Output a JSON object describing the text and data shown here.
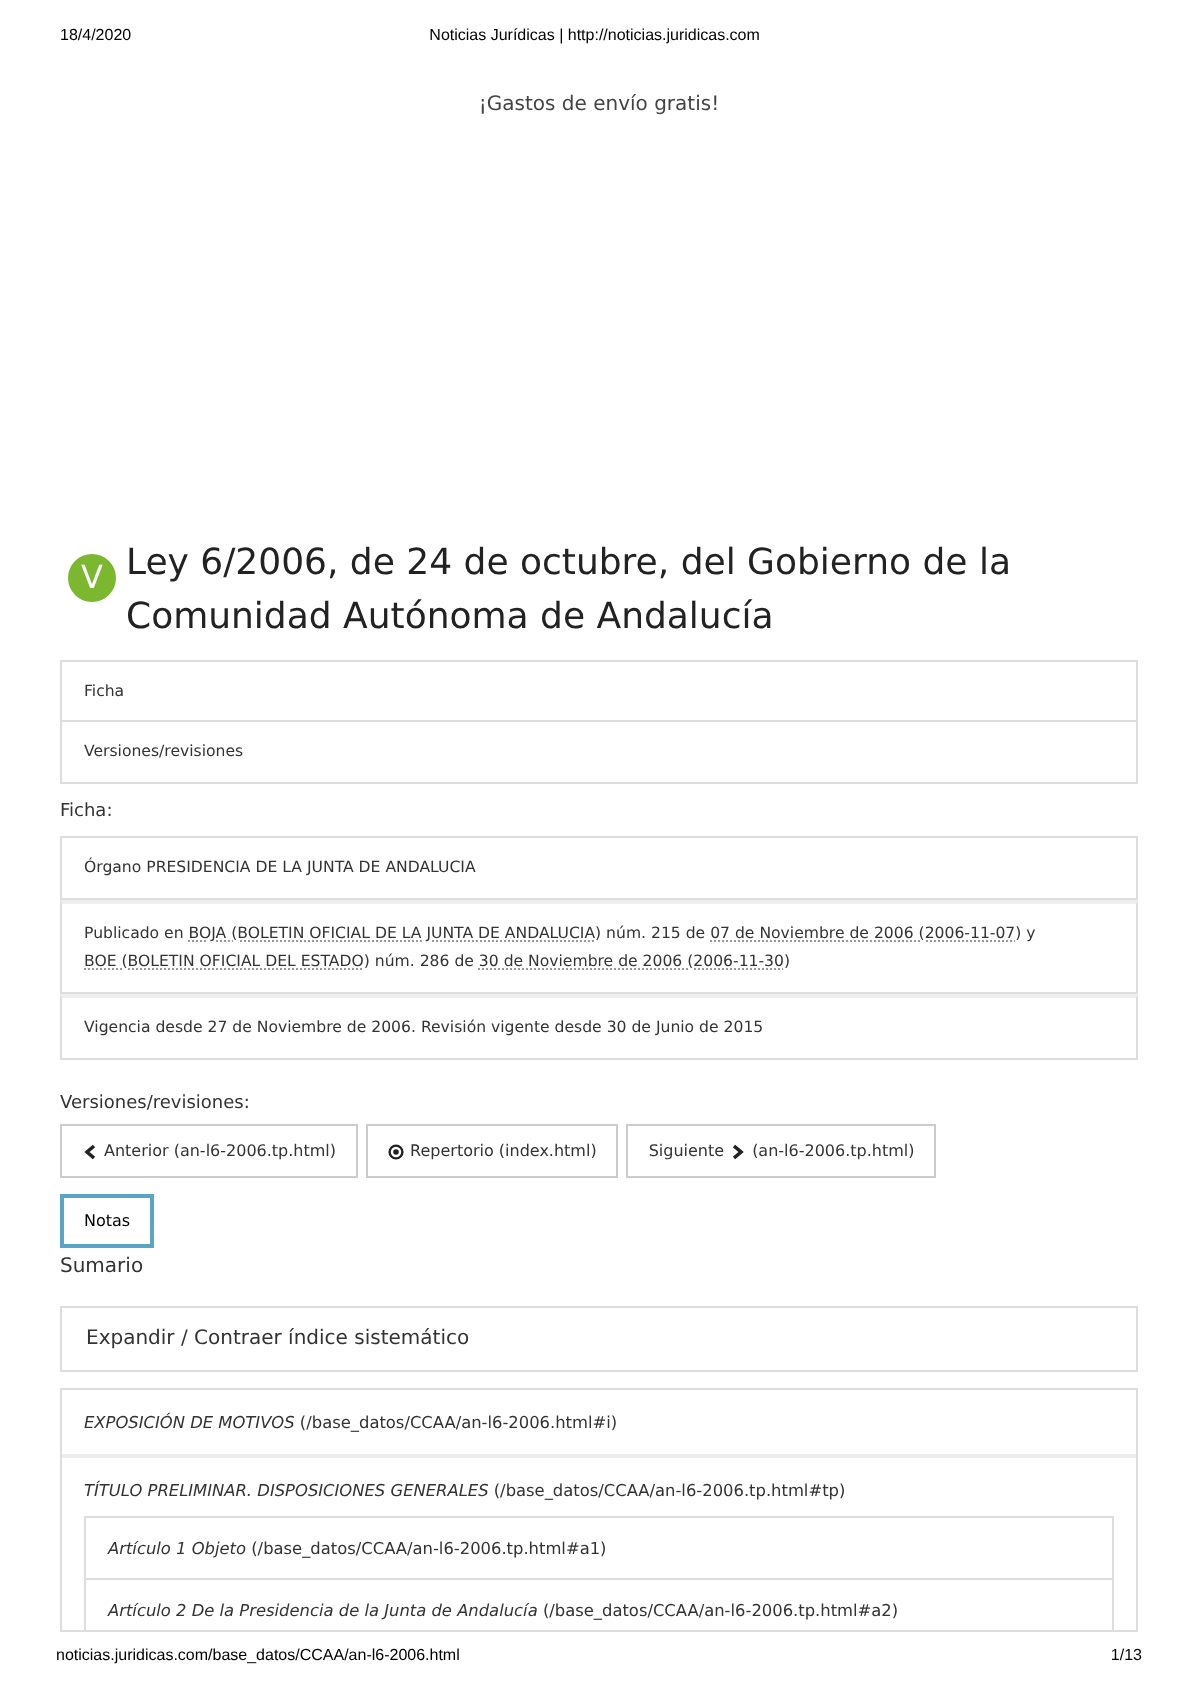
{
  "print_header": {
    "date": "18/4/2020",
    "title": "Noticias Jurídicas | http://noticias.juridicas.com"
  },
  "promo": "¡Gastos de envío gratis!",
  "title": {
    "badge": "V",
    "text": "Ley 6/2006, de 24 de octubre, del Gobierno de la Comunidad Autónoma de Andalucía"
  },
  "nav_list": [
    "Ficha",
    "Versiones/revisiones"
  ],
  "ficha": {
    "heading": "Ficha:",
    "rows": [
      [
        {
          "text": "Órgano PRESIDENCIA DE LA JUNTA DE ANDALUCIA",
          "link": false
        }
      ],
      [
        {
          "text": "Publicado en ",
          "link": false
        },
        {
          "text": "BOJA (BOLETIN OFICIAL DE LA JUNTA DE ANDALUCIA)",
          "link": true
        },
        {
          "text": " núm. 215 de ",
          "link": false
        },
        {
          "text": "07 de Noviembre de 2006 (2006-11-07)",
          "link": true
        },
        {
          "text": " y ",
          "link": false
        },
        {
          "text": "BOE (BOLETIN OFICIAL DEL ESTADO)",
          "link": true
        },
        {
          "text": " núm. 286 de ",
          "link": false
        },
        {
          "text": "30 de Noviembre de 2006 (2006-11-30)",
          "link": true
        }
      ],
      [
        {
          "text": "Vigencia desde 27 de Noviembre de 2006. Revisión vigente desde 30 de Junio de 2015",
          "link": false
        }
      ]
    ]
  },
  "versiones": {
    "heading": "Versiones/revisiones:",
    "buttons": [
      {
        "kind": "prev",
        "label": "Anterior (an-l6-2006.tp.html)"
      },
      {
        "kind": "index",
        "label": "Repertorio (index.html)"
      },
      {
        "kind": "next",
        "label": "Siguiente",
        "suffix": "(an-l6-2006.tp.html)"
      }
    ]
  },
  "notas": {
    "label": "Notas",
    "focused": true
  },
  "sumario": {
    "heading": "Sumario",
    "toggle": "Expandir / Contraer índice sistemático",
    "items": [
      {
        "text": "*EXPOSICIÓN DE MOTIVOS* (/base_datos/CCAA/an-l6-2006.html#i)"
      },
      {
        "text": "*TÍTULO PRELIMINAR.  DISPOSICIONES GENERALES* (/base_datos/CCAA/an-l6-2006.tp.html#tp)",
        "children": [
          {
            "text": "*Artículo 1  Objeto* (/base_datos/CCAA/an-l6-2006.tp.html#a1)"
          },
          {
            "text": "*Artículo 2  De la Presidencia de la Junta de Andalucía* (/base_datos/CCAA/an-l6-2006.tp.html#a2)"
          }
        ]
      }
    ]
  },
  "print_footer": {
    "url": "noticias.juridicas.com/base_datos/CCAA/an-l6-2006.html",
    "page": "1/13"
  }
}
